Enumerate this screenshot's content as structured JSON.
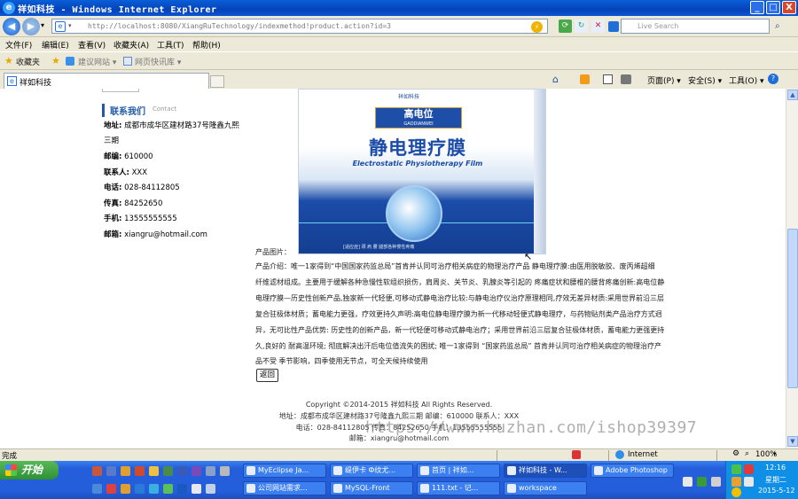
{
  "window": {
    "title": "祥如科技 - Windows Internet Explorer",
    "minimize": "_",
    "maximize": "□",
    "close": "X"
  },
  "address": {
    "url": "http://localhost:8080/XiangRuTechnology/indexmethod!product.action?id=3",
    "search_placeholder": "Live Search"
  },
  "menu": [
    "文件(F)",
    "编辑(E)",
    "查看(V)",
    "收藏夹(A)",
    "工具(T)",
    "帮助(H)"
  ],
  "favorites": {
    "label": "收藏夹",
    "items": [
      "建议网站 ▾",
      "网页快讯库 ▾"
    ]
  },
  "tab": {
    "label": "祥如科技"
  },
  "commands": [
    "页面(P) ▾",
    "安全(S) ▾",
    "工具(O) ▾"
  ],
  "contact": {
    "title": "联系我们",
    "subtitle": "Contact",
    "address_label": "地址:",
    "address_value": "成都市成华区建材路37号隆鑫九熙",
    "address_value_2": "三期",
    "postcode_label": "邮编:",
    "postcode_value": "610000",
    "person_label": "联系人:",
    "person_value": "XXX",
    "phone_label": "电话:",
    "phone_value": "028-84112805",
    "fax_label": "传真:",
    "fax_value": "84252650",
    "mobile_label": "手机:",
    "mobile_value": "13555555555",
    "email_label": "邮箱:",
    "email_value": "xiangru@hotmail.com"
  },
  "product_box": {
    "brand": "祥如科技",
    "badge_cn": "高电位",
    "badge_py": "GAODIANWEI",
    "name_cn": "静电理疗膜",
    "name_en": "Electrostatic Physiotherapy Film",
    "footer": "[适应症] 颈 肩 腰 腿部各种慢性疼痛"
  },
  "product": {
    "image_label": "产品图片：",
    "intro_lines": [
      "产品介绍：唯一1家得到“中国国家药监总局”首肯并认同可治疗相关病症的物理治疗产品 静电理疗膜:由医用脱敏胶、废丙烯超细",
      "纤维滤材组成。主要用于缓解各种急慢性软组织损伤，肩周炎、关节炎、乳腺炎等引起的 疼痛症状和腰椎的腰背疼痛创新:高电位静",
      "电理疗膜—历史性创新产品,独家新一代轻便,可移动式静电治疗比较:与静电治疗仪治疗原理相同,疗效无差异材质:采用世界前沿三层",
      "复合驻极体材质；蓄电能力更强，疗效更持久声明:高电位静电理疗膜为新一代移动轻便式静电理疗，与药物贴剂类产品治疗方式迥",
      "异，无可比性产品优势: 历史性的创新产品，新一代轻便可移动式静电治疗；采用世界前沿三层复合驻极体材质，蓄电能力更强更持",
      "久,良好的 耐高温环境; 彻底解决出汗后电位值流失的困扰; 唯一1家得到 “国家药监总局” 首肯并认同可治疗相关病症的物理治疗产",
      "品不受 季节影响，四季使用无节点，可全天候持续使用"
    ],
    "back_button": "返回"
  },
  "footer": {
    "copyright": "Copyright ©2014-2015  祥如科技  All Rights Reserved.",
    "address": "地址：成都市成华区建材路37号隆鑫九熙三期 邮编：610000 联系人：XXX",
    "phone": "电话：028-84112805 传真：84252650 手机：13555555555",
    "email": "邮箱：xiangru@hotmail.com"
  },
  "watermark": "https://www.huzhan.com/ishop39397",
  "statusbar": {
    "left": "完成",
    "zone": "Internet",
    "zoom": "100%"
  },
  "taskbar": {
    "start": "开始",
    "tasks_row1": [
      "MyEclipse Ja...",
      "缇伊卡 Ф纹尤...",
      "首页 | 祥如...",
      "祥如科技 - W...",
      "Adobe Photoshop"
    ],
    "tasks_row2": [
      "公司网站需求...",
      "MySQL-Front",
      "111.txt - 记...",
      "workspace"
    ],
    "time": "12:16",
    "weekday": "星期二",
    "date": "2015-5-12"
  }
}
